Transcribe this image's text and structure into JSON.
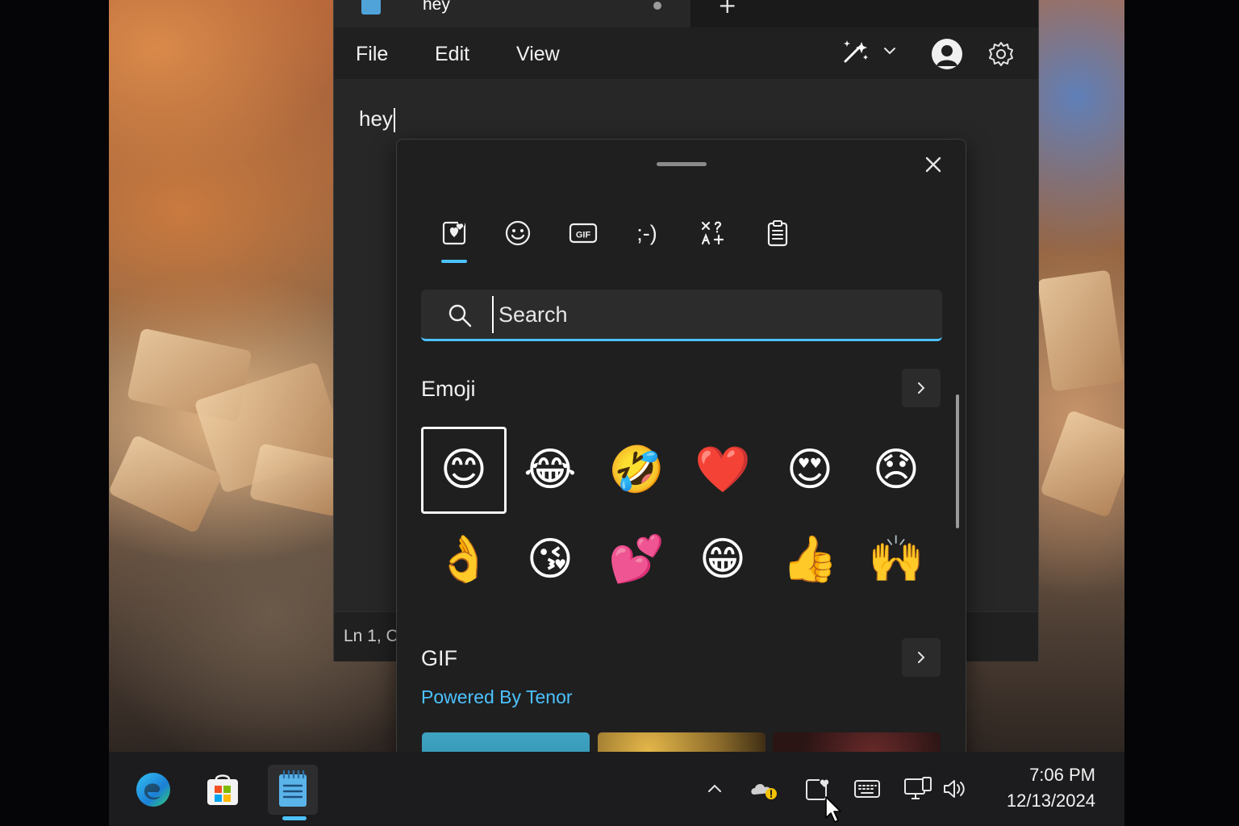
{
  "window": {
    "tab_title": "hey",
    "new_tab_label": "+",
    "menu": {
      "file": "File",
      "edit": "Edit",
      "view": "View"
    },
    "icons": {
      "copilot": "copilot-sparkle-icon",
      "account": "account-icon",
      "settings": "gear-icon"
    }
  },
  "editor": {
    "text": "hey"
  },
  "statusbar": {
    "position": "Ln 1, C"
  },
  "emoji_panel": {
    "categories": [
      {
        "name": "recent",
        "icon": "heart-clipboard-icon",
        "selected": true
      },
      {
        "name": "emoji",
        "icon": "smiley-icon"
      },
      {
        "name": "gif",
        "icon": "gif-icon",
        "label": "GIF"
      },
      {
        "name": "kaomoji",
        "icon": "kaomoji-icon",
        "label": ";-)"
      },
      {
        "name": "symbols",
        "icon": "symbols-icon"
      },
      {
        "name": "clipboard",
        "icon": "clipboard-history-icon"
      }
    ],
    "search": {
      "placeholder": "Search"
    },
    "emoji_section": {
      "title": "Emoji",
      "items": [
        "😊",
        "😂",
        "🤣",
        "❤️",
        "😍",
        "😞",
        "👌",
        "😘",
        "💕",
        "😁",
        "👍",
        "🙌"
      ]
    },
    "gif_section": {
      "title": "GIF",
      "powered_by": "Powered By Tenor"
    },
    "accent_color": "#4cc2ff"
  },
  "taskbar": {
    "apps": [
      {
        "name": "Microsoft Edge",
        "icon": "edge-icon"
      },
      {
        "name": "Microsoft Store",
        "icon": "store-icon"
      },
      {
        "name": "Notepad",
        "icon": "notepad-icon",
        "active": true
      }
    ],
    "tray": [
      "chevron-up-icon",
      "onedrive-warning-icon",
      "emoji-panel-icon",
      "touch-keyboard-icon",
      "network-icon",
      "volume-icon"
    ],
    "clock": {
      "time": "7:06 PM",
      "date": "12/13/2024"
    }
  }
}
